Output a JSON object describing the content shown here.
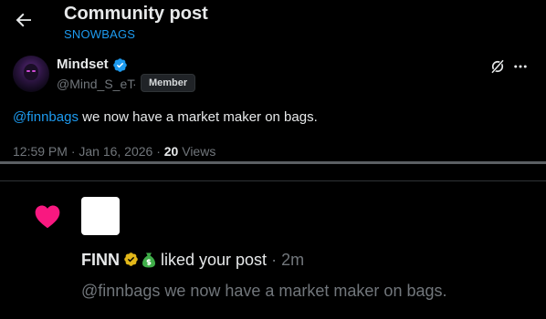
{
  "header": {
    "title": "Community post",
    "community": "SNOWBAGS"
  },
  "post": {
    "author_name": "Mindset",
    "author_handle": "@Mind_S_eT",
    "separator": "·",
    "role_badge": "Member",
    "mention": "@finnbags",
    "body": " we now have a market maker on bags.",
    "time": "12:59 PM · Jan 16, 2026 · ",
    "views_count": "20",
    "views_label": " Views"
  },
  "notification": {
    "user_name": "FINN",
    "action": "liked your post",
    "separator": " · ",
    "time": "2m",
    "quote": "@finnbags we now have a market maker on bags."
  },
  "colors": {
    "accent": "#1d9bf0",
    "like": "#f91880",
    "gold_badge": "#e2b719"
  }
}
